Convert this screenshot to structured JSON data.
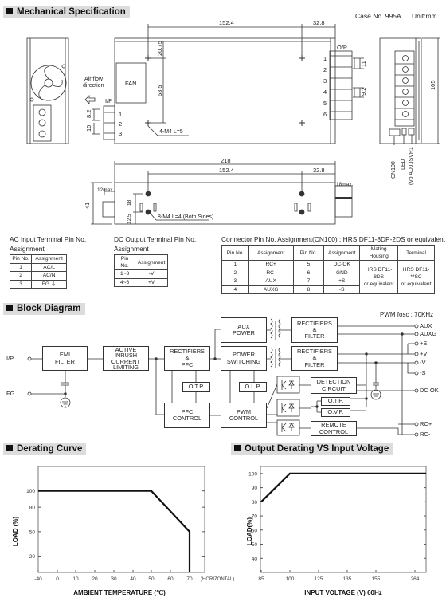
{
  "sections": {
    "mechanical": "Mechanical Specification",
    "block": "Block Diagram",
    "derating": "Derating Curve",
    "output_derating": "Output Derating VS Input Voltage"
  },
  "mechanical": {
    "case_no": "Case No. 995A",
    "unit": "Unit:mm",
    "fan": "FAN",
    "airflow_1": "Air flow",
    "airflow_2": "direction",
    "ip": "I/P",
    "op": "O/P",
    "dims": {
      "d152": "152.4",
      "d328": "32.8",
      "d2075": "20.75",
      "d635": "63.5",
      "d11": "11",
      "d92": "9.2",
      "d82": "8.2",
      "d10": "10",
      "d105": "105",
      "d218": "218",
      "d41": "41",
      "d12max": "12max.",
      "d18max": "18max.",
      "d18": "18",
      "d125": "12.5"
    },
    "screw_top": "4-M4 L=5",
    "screw_bottom": "8-M4 L=4 (Both Sides)",
    "ip_pins": [
      "1",
      "2",
      "3"
    ],
    "op_pins": [
      "1",
      "2",
      "3",
      "4",
      "5",
      "6"
    ],
    "side_labels": [
      "CN100",
      "LED",
      "(Vo ADJ.)SVR1"
    ]
  },
  "tables": {
    "ac": {
      "title_1": "AC Input Terminal Pin No.",
      "title_2": "Assignment",
      "header": [
        "Pin No.",
        "Assignment"
      ],
      "rows": [
        [
          "1",
          "AC/L"
        ],
        [
          "2",
          "AC/N"
        ],
        [
          "3",
          "FG ⏚"
        ]
      ]
    },
    "dc": {
      "title_1": "DC Output Terminal Pin No.",
      "title_2": "Assignment",
      "header": [
        "Pin No.",
        "Assignment"
      ],
      "rows": [
        [
          "1~3",
          "-V"
        ],
        [
          "4~6",
          "+V"
        ]
      ]
    },
    "cn": {
      "title": "Connector Pin No. Assignment(CN100) : HRS DF11-8DP-2DS or equivalent",
      "header": [
        "Pin No.",
        "Assignment",
        "Pin No.",
        "Assignment",
        "Mating Housing",
        "Terminal"
      ],
      "rows": [
        [
          "1",
          "RC+",
          "5",
          "DC-OK"
        ],
        [
          "2",
          "RC-",
          "6",
          "GND"
        ],
        [
          "3",
          "AUX",
          "7",
          "+S"
        ],
        [
          "4",
          "AUXG",
          "8",
          "-S"
        ]
      ],
      "housing": "HRS DF11-8DS\nor equivalent",
      "terminal": "HRS DF11-**SC\nor equivalent"
    }
  },
  "block_diagram": {
    "pwm_fosc": "PWM fosc : 70KHz",
    "ip": "I/P",
    "fg": "FG",
    "blocks": {
      "emi": "EMI\nFILTER",
      "inrush": "ACTIVE\nINRUSH\nCURRENT\nLIMITING",
      "rect_pfc": "RECTIFIERS\n&\nPFC",
      "aux_power": "AUX\nPOWER",
      "power_sw": "POWER\nSWITCHING",
      "rect_filter_1": "RECTIFIERS\n&\nFILTER",
      "rect_filter_2": "RECTIFIERS\n&\nFILTER",
      "otp_1": "O.T.P.",
      "pfc_ctrl": "PFC\nCONTROL",
      "olp": "O.L.P.",
      "pwm_ctrl": "PWM\nCONTROL",
      "detection": "DETECTION\nCIRCUIT",
      "otp_2": "O.T.P.",
      "ovp": "O.V.P.",
      "remote": "REMOTE\nCONTROL"
    },
    "outputs": [
      "AUX",
      "AUXG",
      "+S",
      "+V",
      "-V",
      "-S",
      "DC OK",
      "RC+",
      "RC-"
    ]
  },
  "chart_data": [
    {
      "type": "line",
      "title": "Derating Curve",
      "xlabel": "AMBIENT TEMPERATURE (℃)",
      "ylabel": "LOAD (%)",
      "x_note": "(HORIZONTAL)",
      "xticks": [
        -40,
        0,
        10,
        20,
        30,
        40,
        50,
        60,
        70
      ],
      "yticks": [
        100,
        80,
        50,
        20
      ],
      "ylim": [
        0,
        130
      ],
      "grid": false,
      "line_color": "#111111",
      "points": [
        [
          -40,
          100
        ],
        [
          50,
          100
        ],
        [
          70,
          50
        ],
        [
          70,
          0
        ]
      ]
    },
    {
      "type": "line",
      "title": "Output Derating VS Input Voltage",
      "xlabel": "INPUT VOLTAGE (V) 60Hz",
      "ylabel": "LOAD(%)",
      "xticks": [
        85,
        100,
        125,
        135,
        155,
        264
      ],
      "yticks": [
        100,
        90,
        80,
        70,
        60,
        50,
        40
      ],
      "ylim": [
        30,
        105
      ],
      "grid": false,
      "line_color": "#111111",
      "points": [
        [
          85,
          80
        ],
        [
          100,
          100
        ],
        [
          264,
          100
        ]
      ]
    }
  ]
}
